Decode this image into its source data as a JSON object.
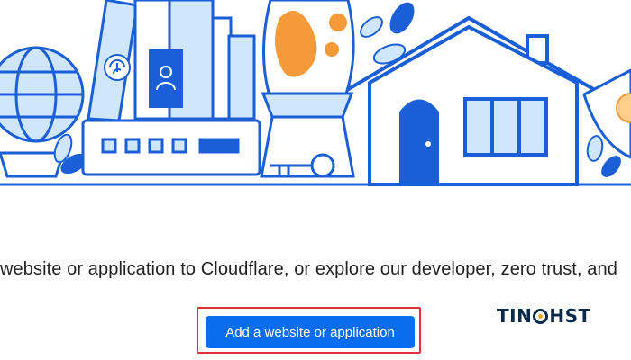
{
  "subtitle": "website or application to Cloudflare, or explore our developer, zero trust, and",
  "cta_label": "Add a website or application",
  "watermark": {
    "part1": "TIN",
    "part2": "HST"
  },
  "colors": {
    "accent": "#0a6df0",
    "illustration_blue": "#1a5fd6",
    "illustration_light": "#cfe6fb",
    "flame_orange": "#f59a38",
    "highlight_red": "#e0323a"
  }
}
